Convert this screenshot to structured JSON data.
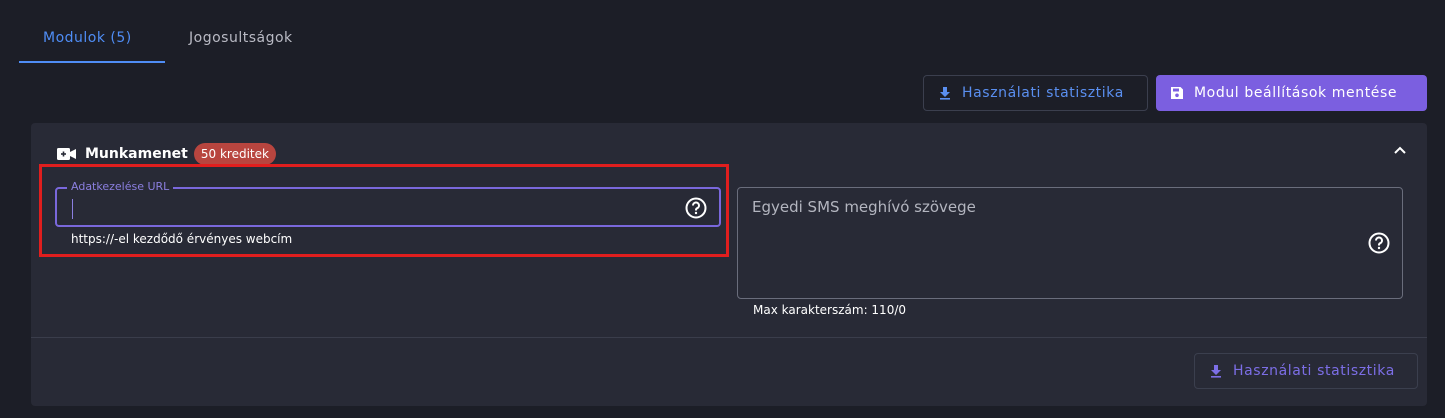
{
  "tabs": [
    {
      "label": "Modulok (5)",
      "active": true
    },
    {
      "label": "Jogosultságok",
      "active": false
    }
  ],
  "toolbar": {
    "stats_button_label": "Használati statisztika",
    "save_button_label": "Modul beállítások mentése",
    "icons": {
      "stats": "download-icon",
      "save": "save-icon"
    }
  },
  "module": {
    "title": "Munkamenet",
    "icon": "video-add-icon",
    "credits_badge": "50 kreditek",
    "collapse_icon": "chevron-up-icon",
    "url_field": {
      "label": "Adatkezelése URL",
      "value": "",
      "hint": "https://-el kezdődő érvényes webcím",
      "help_icon": "help-circle-icon"
    },
    "sms_field": {
      "placeholder": "Egyedi SMS meghívó szövege",
      "value": "",
      "counter": "Max karakterszám: 110/0",
      "help_icon": "help-circle-icon"
    },
    "footer_stats_button_label": "Használati statisztika"
  },
  "colors": {
    "background": "#1c1e27",
    "panel": "#282a36",
    "accent_blue": "#4f8df5",
    "primary_purple": "#7b5fe0",
    "badge_red": "#b8453f",
    "highlight_red": "#e01e1e"
  }
}
